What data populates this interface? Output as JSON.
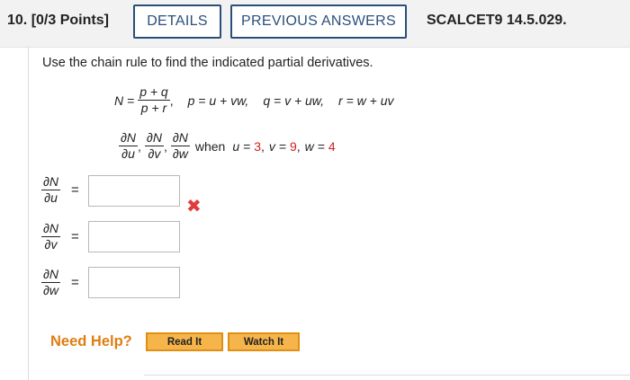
{
  "header": {
    "question_label": "10. [0/3 Points]",
    "tabs": [
      {
        "label": "DETAILS"
      },
      {
        "label": "PREVIOUS ANSWERS"
      }
    ],
    "reference": "SCALCET9 14.5.029."
  },
  "problem": {
    "instruction": "Use the chain rule to find the indicated partial derivatives.",
    "N_lhs": "N =",
    "N_numerator": "p + q",
    "N_denominator": "p + r",
    "p_def": "p = u + vw,",
    "q_def": "q = v + uw,",
    "r_def": "r = w + uv",
    "partials": [
      {
        "num": "∂N",
        "den": "∂u"
      },
      {
        "num": "∂N",
        "den": "∂v"
      },
      {
        "num": "∂N",
        "den": "∂w"
      }
    ],
    "when_text": "when",
    "u_label": "u =",
    "u_val": "3",
    "v_label": "v =",
    "v_val": "9",
    "w_label": "w =",
    "w_val": "4",
    "value_color": "#d21f1f"
  },
  "answers": [
    {
      "num": "∂N",
      "den": "∂u",
      "eq": "=",
      "value": "",
      "status": "incorrect"
    },
    {
      "num": "∂N",
      "den": "∂v",
      "eq": "=",
      "value": ""
    },
    {
      "num": "∂N",
      "den": "∂w",
      "eq": "=",
      "value": ""
    }
  ],
  "status_icon": "x-mark-icon",
  "incorrect_mark": "✖",
  "help": {
    "label": "Need Help?",
    "read_button": "Read It",
    "watch_button": "Watch It"
  }
}
